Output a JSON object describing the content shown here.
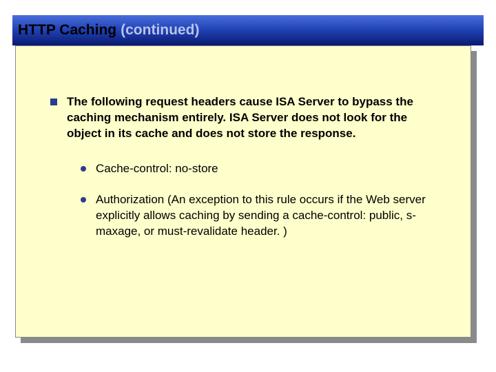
{
  "title": {
    "main": "HTTP Caching",
    "continued": "(continued)"
  },
  "bullet": {
    "text": "The following request headers cause ISA Server to bypass the caching mechanism entirely. ISA Server does not look for the object in its cache and does not store the response.",
    "subs": [
      "Cache-control: no-store",
      "Authorization (An exception to this rule occurs if the Web server explicitly allows caching by sending a cache-control: public, s-maxage, or must-revalidate header. )"
    ]
  }
}
